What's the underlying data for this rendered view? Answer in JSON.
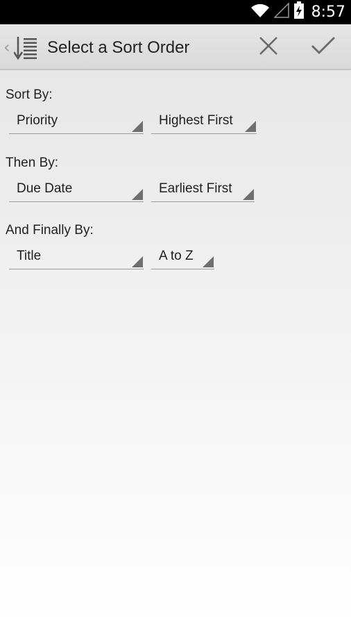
{
  "status_bar": {
    "time": "8:57",
    "icons": [
      "wifi-icon",
      "signal-icon",
      "battery-charging-icon"
    ]
  },
  "action_bar": {
    "up_icon": "chevron-left-icon",
    "app_icon": "sort-list-icon",
    "title": "Select a Sort Order",
    "cancel_icon": "close-icon",
    "confirm_icon": "checkmark-icon"
  },
  "sort": {
    "primary": {
      "label": "Sort By:",
      "field": "Priority",
      "direction": "Highest First"
    },
    "secondary": {
      "label": "Then By:",
      "field": "Due Date",
      "direction": "Earliest First"
    },
    "tertiary": {
      "label": "And Finally By:",
      "field": "Title",
      "direction": "A to Z"
    }
  },
  "colors": {
    "status_bar": "#000000",
    "action_bar": "#dedede",
    "spinner_arrow": "#6f6f6f",
    "divider": "#9c9c9c"
  }
}
